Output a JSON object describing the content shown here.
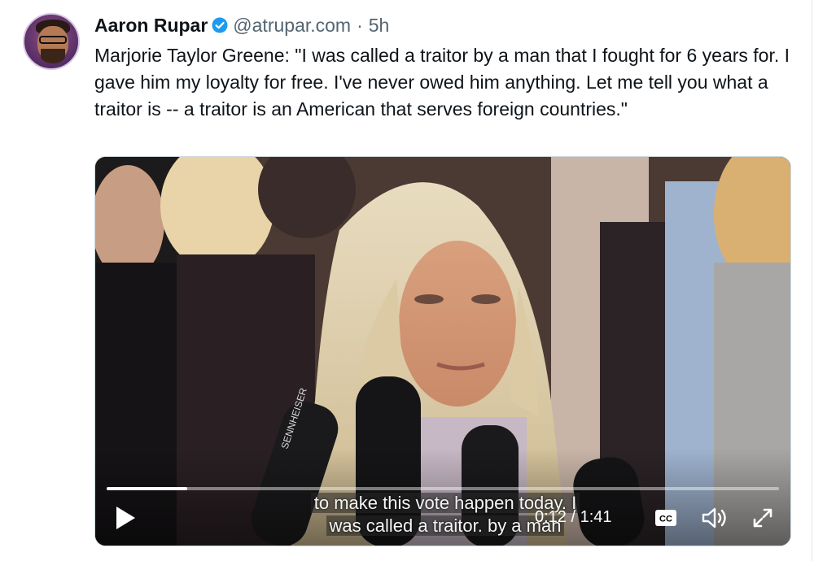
{
  "post": {
    "author_name": "Aaron Rupar",
    "handle": "@atrupar.com",
    "separator": "·",
    "timestamp": "5h",
    "text": "Marjorie Taylor Greene: \"I was called a traitor by a man that I fought for 6 years for. I gave him my loyalty for free. I've never owed him anything. Let me tell you what a traitor is -- a traitor is an American that serves foreign countries.\""
  },
  "video": {
    "caption_line1": "to make this vote happen today. I",
    "caption_line2": "was called a traitor. by a man",
    "time": "0:12 / 1:41",
    "progress_fraction": 0.12,
    "cc_label": "CC",
    "mic_brand": "SENNHEISER",
    "icons": [
      "play-icon",
      "closed-captions-icon",
      "volume-icon",
      "fullscreen-icon"
    ]
  },
  "colors": {
    "verified_badge": "#1d9bf0",
    "text_primary": "#0f1419",
    "text_secondary": "#536471"
  }
}
